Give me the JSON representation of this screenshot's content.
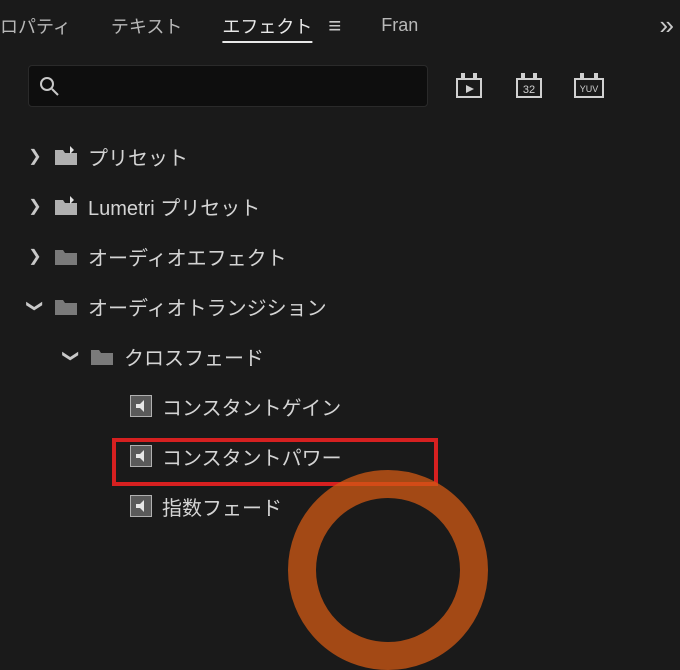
{
  "tabs": {
    "properties": "ロパティ",
    "text": "テキスト",
    "effects": "エフェクト",
    "overflow_label": "Fran",
    "menu_glyph": "≡",
    "overflow_glyph": "»"
  },
  "search": {
    "value": "",
    "placeholder": ""
  },
  "toolbar_icons": {
    "fx_badge": "▸",
    "num_badge": "32",
    "yuv_badge": "YUV"
  },
  "tree": {
    "presets": "プリセット",
    "lumetri_presets": "Lumetri プリセット",
    "audio_effects": "オーディオエフェクト",
    "audio_transitions": "オーディオトランジション",
    "crossfade": "クロスフェード",
    "constant_gain": "コンスタントゲイン",
    "constant_power": "コンスタントパワー",
    "exponential_fade": "指数フェード"
  },
  "icons": {
    "arrow_right": "❯",
    "arrow_down": "❯"
  }
}
